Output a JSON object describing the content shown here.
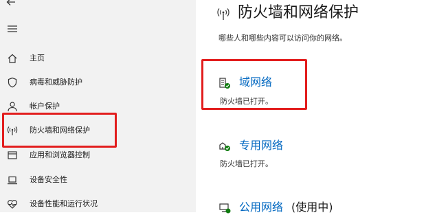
{
  "sidebar": {
    "items": [
      {
        "label": "主页",
        "icon": "home-icon"
      },
      {
        "label": "病毒和威胁防护",
        "icon": "shield-icon"
      },
      {
        "label": "帐户保护",
        "icon": "person-icon"
      },
      {
        "label": "防火墙和网络保护",
        "icon": "antenna-icon"
      },
      {
        "label": "应用和浏览器控制",
        "icon": "app-window-icon"
      },
      {
        "label": "设备安全性",
        "icon": "laptop-icon"
      },
      {
        "label": "设备性能和运行状况",
        "icon": "heart-icon"
      }
    ],
    "icons": {
      "back": "back-arrow-icon",
      "menu": "hamburger-menu-icon"
    }
  },
  "main": {
    "title": "防火墙和网络保护",
    "title_icon": "antenna-icon",
    "subtitle": "哪些人和哪些内容可以访问你的网络。",
    "networks": [
      {
        "name": "域网络",
        "status": "防火墙已打开。",
        "icon": "domain-network-icon"
      },
      {
        "name": "专用网络",
        "status": "防火墙已打开。",
        "icon": "private-network-icon"
      },
      {
        "name": "公用网络",
        "suffix": "(使用中)",
        "icon": "public-network-icon"
      }
    ]
  },
  "colors": {
    "accent": "#0067c0",
    "highlight": "#e21d1d",
    "sidebar_bg": "#f2f2f2",
    "check": "#107c10"
  }
}
